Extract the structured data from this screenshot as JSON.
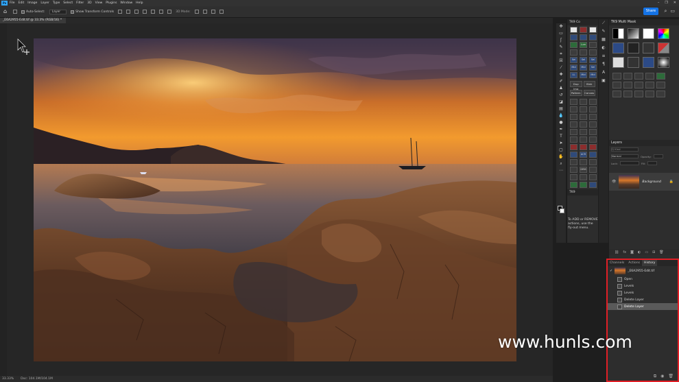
{
  "menubar": {
    "app_icon": "Ps",
    "items": [
      "File",
      "Edit",
      "Image",
      "Layer",
      "Type",
      "Select",
      "Filter",
      "3D",
      "View",
      "Plugins",
      "Window",
      "Help"
    ]
  },
  "options": {
    "home_icon": "home-icon",
    "auto_select_label": "Auto-Select:",
    "auto_select_value": "Layer",
    "transform_label": "Show Transform Controls",
    "mode3d_label": "3D Mode:",
    "share_label": "Share"
  },
  "document": {
    "tab_title": "_E6A2955-Edit.tif @ 33.3% (RGB/16) *"
  },
  "status": {
    "zoom": "33.33%",
    "doc_info": "Doc: 104.1M/104.1M"
  },
  "tk9co": {
    "title": "TK9 Co",
    "buttons": [
      "",
      "",
      "",
      "",
      "",
      "",
      "",
      "Lum",
      "",
      "",
      "",
      "",
      "Sel",
      "Sel",
      "Sel",
      "Mid",
      "Mid",
      "Sel",
      "LL",
      "Mid",
      "Mid"
    ],
    "wide1": [
      "Dup Img",
      "Blnk"
    ],
    "wide2": [
      "Pattern",
      "Canvas"
    ],
    "buttons2": [
      "",
      "",
      "",
      "",
      "",
      "",
      "",
      "",
      "",
      "",
      "",
      "",
      "",
      "",
      "",
      "",
      "",
      "",
      "",
      "",
      "",
      "",
      "ACR",
      "",
      "",
      "",
      "",
      "",
      "DRM",
      "",
      "",
      "",
      "",
      "",
      "",
      ""
    ],
    "panel2_title": "TK9",
    "note": "To ADD or REMOVE actions, use the fly-out menu."
  },
  "multimask": {
    "title": "TK9 Multi Mask",
    "big_buttons": [
      "",
      "",
      "",
      "",
      "",
      "",
      "",
      "",
      "",
      "",
      "",
      ""
    ],
    "small_buttons": [
      "",
      "",
      "",
      "",
      "",
      "",
      "",
      "",
      "",
      "",
      "",
      "",
      "",
      "",
      ""
    ]
  },
  "layers": {
    "title": "Layers",
    "search_placeholder": "Q Kind",
    "blend_mode": "Normal",
    "opacity_label": "Opacity:",
    "lock_label": "Lock:",
    "fill_label": "Fill:",
    "layer_name": "Background"
  },
  "history": {
    "tabs": [
      "Channels",
      "Actions",
      "History"
    ],
    "snapshot": "_E6A2955-Edit.tif",
    "steps": [
      "Open",
      "Levels",
      "Levels",
      "Delete Layer",
      "Delete Layer"
    ]
  },
  "watermark": "www.hunls.com"
}
